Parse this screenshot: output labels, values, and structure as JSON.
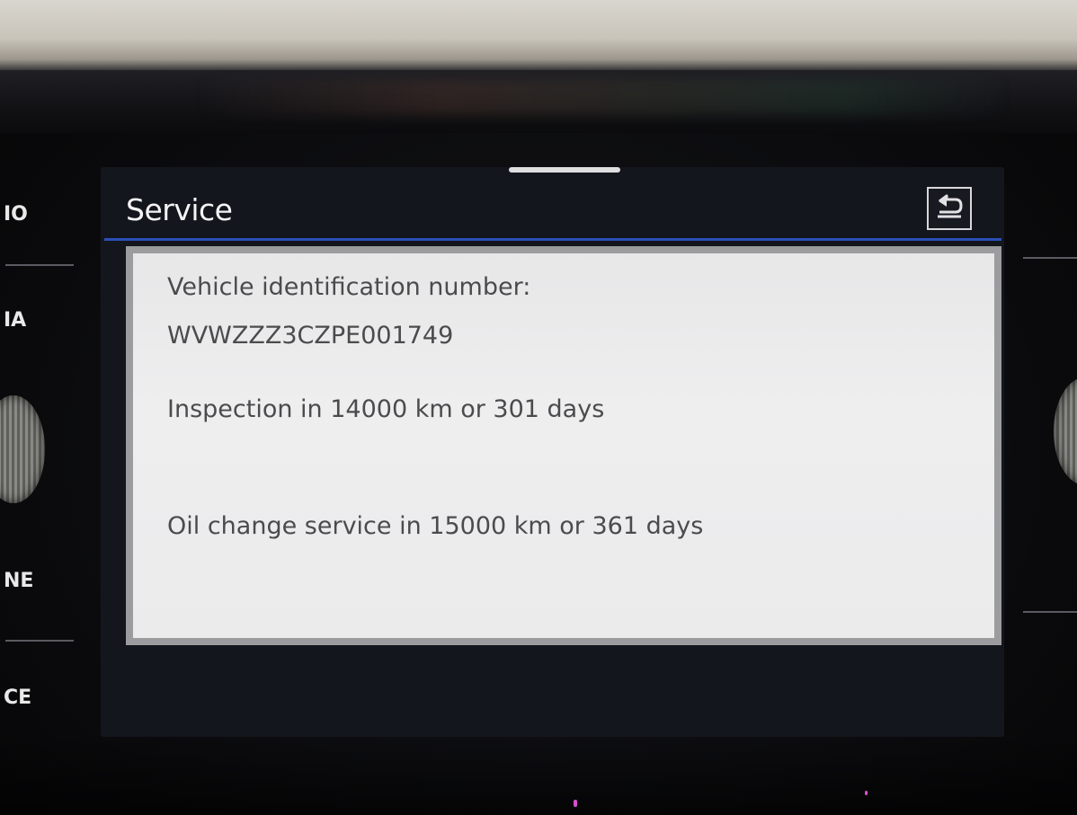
{
  "screen": {
    "title": "Service",
    "back_icon": "back-arrow-icon"
  },
  "service_info": {
    "vin_label": "Vehicle identification number:",
    "vin_value": "WVWZZZ3CZPE001749",
    "inspection": "Inspection in 14000 km or 301 days",
    "oil_change": "Oil change service in 15000 km or 361 days"
  },
  "side_buttons": {
    "labels": [
      "IO",
      "IA",
      "NE",
      "CE"
    ]
  },
  "colors": {
    "accent_underline": "#2a4fb8",
    "panel_background": "#ebebec",
    "screen_background": "#14161d",
    "text_dark": "#4b4b4e"
  }
}
